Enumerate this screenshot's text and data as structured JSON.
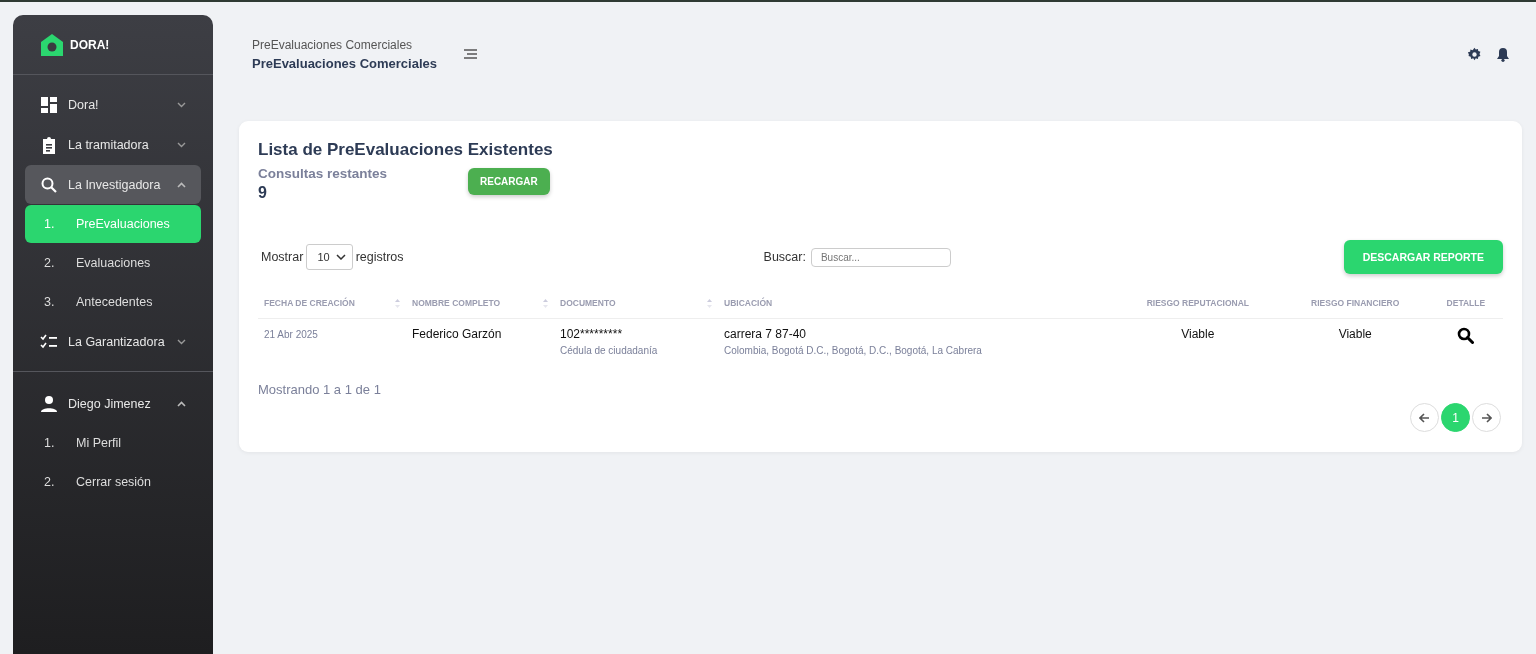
{
  "sidebar": {
    "brand": "DORA!",
    "menu": [
      {
        "label": "Dora!",
        "expanded": false,
        "selected": false
      },
      {
        "label": "La tramitadora",
        "expanded": false,
        "selected": false
      },
      {
        "label": "La Investigadora",
        "expanded": true,
        "selected": true,
        "children": [
          {
            "number": "1.",
            "label": "PreEvaluaciones",
            "selected": true
          },
          {
            "number": "2.",
            "label": "Evaluaciones",
            "selected": false
          },
          {
            "number": "3.",
            "label": "Antecedentes",
            "selected": false
          }
        ]
      },
      {
        "label": "La Garantizadora",
        "expanded": false,
        "selected": false
      }
    ],
    "account": [
      {
        "label": "Diego Jimenez",
        "expanded": true,
        "selected": false,
        "children": [
          {
            "number": "1.",
            "label": "Mi Perfil",
            "selected": false
          },
          {
            "number": "2.",
            "label": "Cerrar sesión",
            "selected": false
          }
        ]
      }
    ]
  },
  "header": {
    "breadcrumb": "PreEvaluaciones Comerciales",
    "title": "PreEvaluaciones Comerciales"
  },
  "card": {
    "title": "Lista de PreEvaluaciones Existentes",
    "remaining_label": "Consultas restantes",
    "remaining_value": "9",
    "reload_button": "RECARGAR",
    "show_label": "Mostrar",
    "page_size": "10",
    "records_label": "registros",
    "search_label": "Buscar:",
    "search": {
      "placeholder": "Buscar..."
    },
    "download_button": "DESCARGAR REPORTE",
    "table": {
      "columns": [
        {
          "label": "FECHA DE CREACIÓN",
          "sortable": true
        },
        {
          "label": "NOMBRE COMPLETO",
          "sortable": true
        },
        {
          "label": "DOCUMENTO",
          "sortable": true
        },
        {
          "label": "UBICACIÓN",
          "sortable": false
        },
        {
          "label": "RIESGO REPUTACIONAL",
          "sortable": false
        },
        {
          "label": "RIESGO FINANCIERO",
          "sortable": false
        },
        {
          "label": "DETALLE",
          "sortable": false
        }
      ],
      "rows": [
        {
          "date": "21 Abr 2025",
          "name": "Federico Garzón",
          "document": "102*********",
          "document_type": "Cédula de ciudadanía",
          "address": "carrera 7 87-40",
          "location": "Colombia, Bogotá D.C., Bogotá, D.C., Bogotá, La Cabrera",
          "reputational_risk": "Viable",
          "financial_risk": "Viable"
        }
      ]
    },
    "summary": "Mostrando 1 a 1 de 1",
    "pages": [
      {
        "label": "1",
        "selected": true
      }
    ]
  }
}
